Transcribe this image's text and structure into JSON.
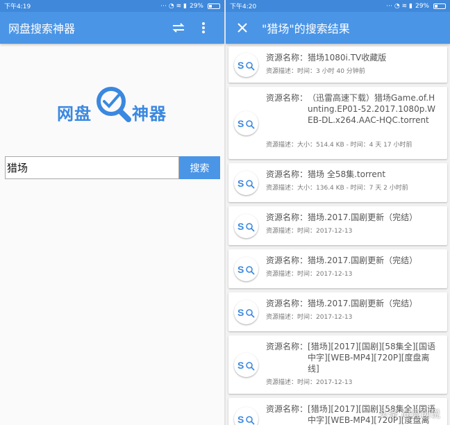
{
  "left": {
    "status": {
      "time": "下午4:19",
      "battery": "29%"
    },
    "appbar": {
      "title": "网盘搜索神器",
      "swap_icon": "swap-icon",
      "menu_icon": "more-vert-icon"
    },
    "logo": {
      "left": "网盘",
      "right": "神器"
    },
    "search": {
      "value": "猎场",
      "button": "搜索"
    }
  },
  "right": {
    "status": {
      "time": "下午4:20",
      "battery": "29%"
    },
    "appbar": {
      "title": "\"猎场\"的搜索结果",
      "close_icon": "close-icon"
    },
    "name_label": "资源名称：",
    "desc_label": "资源描述：",
    "results": [
      {
        "name": "猎场1080i.TV收藏版",
        "desc": "时间：3 小时 40 分钟前"
      },
      {
        "name": "（迅雷高速下载）猎场Game.of.Hunting.EP01-52.2017.1080p.WEB-DL.x264.AAC-HQC.torrent",
        "desc": "大小：514.4 KB - 时间：4 天 17 小时前"
      },
      {
        "name": "猎场 全58集.torrent",
        "desc": "大小：136.4 KB - 时间：7 天 2 小时前"
      },
      {
        "name": "猎场.2017.国剧更新（完结）",
        "desc": "时间：2017-12-13"
      },
      {
        "name": "猎场.2017.国剧更新（完结）",
        "desc": "时间：2017-12-13"
      },
      {
        "name": "猎场.2017.国剧更新（完结）",
        "desc": "时间：2017-12-13"
      },
      {
        "name": "[猎场][2017][国剧][58集全][国语中字][WEB-MP4][720P][度盘离线]",
        "desc": "时间：2017-12-13"
      },
      {
        "name": "[猎场][2017][国剧][58集全][国语中字][WEB-MP4][720P][度盘离",
        "desc": ""
      }
    ],
    "watermark": "头条 @亮创说"
  },
  "colors": {
    "accent": "#4b95e6",
    "statusbar": "#3f88da",
    "logo": "#3a88e0"
  }
}
